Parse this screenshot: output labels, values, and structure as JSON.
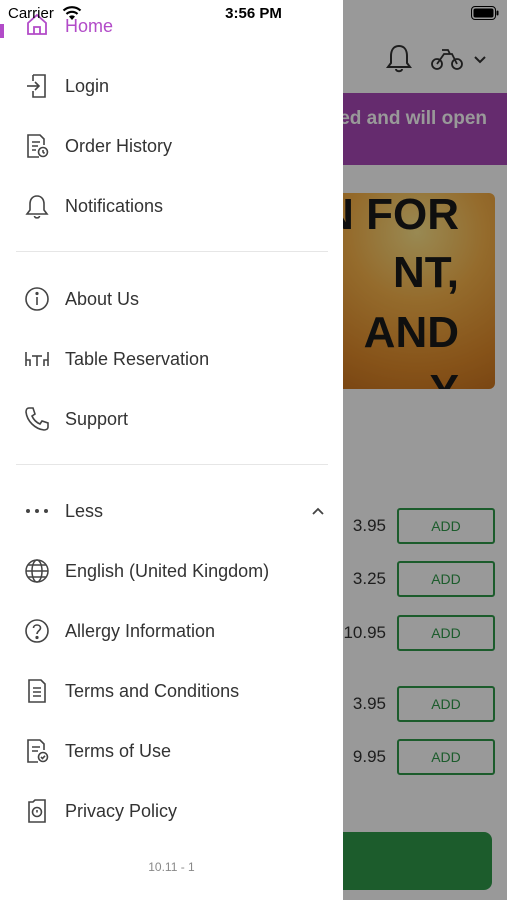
{
  "status_bar": {
    "carrier": "Carrier",
    "time": "3:56 PM"
  },
  "background_app": {
    "banner_text": "ed and will open",
    "promo_lines": [
      "N FOR",
      "NT,",
      "AND",
      "Y"
    ],
    "menu_rows": [
      {
        "price": "3.95",
        "add_label": "ADD"
      },
      {
        "price": "3.25",
        "add_label": "ADD"
      },
      {
        "price": "10.95",
        "add_label": "ADD"
      },
      {
        "price": "3.95",
        "add_label": "ADD"
      },
      {
        "price": "9.95",
        "add_label": "ADD"
      }
    ]
  },
  "drawer": {
    "accent_color": "#b24bc8",
    "home_label": "Home",
    "items_group1": [
      {
        "label": "Login",
        "icon": "login-icon"
      },
      {
        "label": "Order History",
        "icon": "order-history-icon"
      },
      {
        "label": "Notifications",
        "icon": "bell-icon"
      }
    ],
    "items_group2": [
      {
        "label": "About Us",
        "icon": "info-icon"
      },
      {
        "label": "Table Reservation",
        "icon": "table-icon"
      },
      {
        "label": "Support",
        "icon": "phone-icon"
      }
    ],
    "less_label": "Less",
    "items_group3": [
      {
        "label": "English (United Kingdom)",
        "icon": "globe-icon"
      },
      {
        "label": "Allergy Information",
        "icon": "question-icon"
      },
      {
        "label": "Terms and Conditions",
        "icon": "document-icon"
      },
      {
        "label": "Terms of Use",
        "icon": "document-check-icon"
      },
      {
        "label": "Privacy Policy",
        "icon": "privacy-icon"
      }
    ],
    "version": "10.11 - 1"
  }
}
